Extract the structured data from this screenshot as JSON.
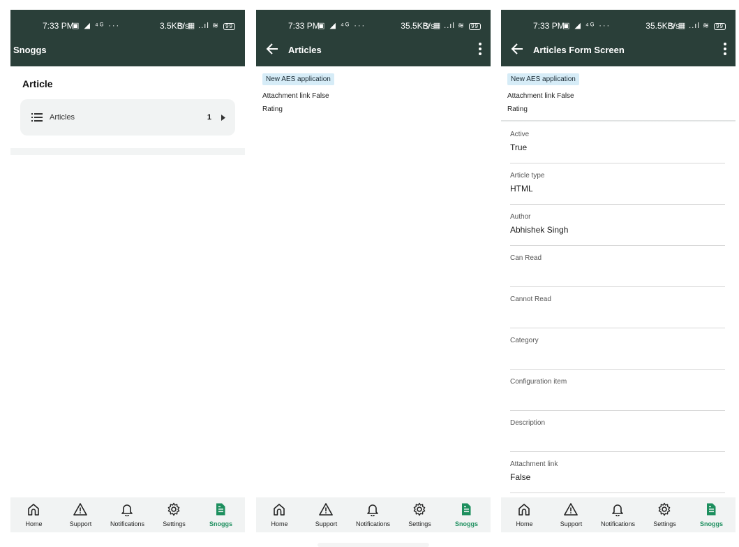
{
  "status": {
    "screen1": {
      "time": "7:33 PM",
      "speed": "3.5KB/s",
      "battery": "99"
    },
    "screen2": {
      "time": "7:33 PM",
      "speed": "35.5KB/s",
      "battery": "99"
    },
    "screen3": {
      "time": "7:33 PM",
      "speed": "35.5KB/s",
      "battery": "99"
    }
  },
  "screen1": {
    "appbar_title": "Snoggs",
    "section_title": "Article",
    "card": {
      "label": "Articles",
      "count": "1"
    }
  },
  "screen2": {
    "appbar_title": "Articles",
    "item": {
      "chip": "New AES application",
      "line1": "Attachment link False",
      "line2": "Rating"
    }
  },
  "screen3": {
    "appbar_title": "Articles Form Screen",
    "header": {
      "chip": "New AES application",
      "line1": "Attachment link False",
      "line2": "Rating"
    },
    "fields": [
      {
        "label": "Active",
        "value": "True"
      },
      {
        "label": "Article type",
        "value": "HTML"
      },
      {
        "label": "Author",
        "value": "Abhishek Singh"
      },
      {
        "label": "Can Read",
        "value": ""
      },
      {
        "label": "Cannot Read",
        "value": ""
      },
      {
        "label": "Category",
        "value": ""
      },
      {
        "label": "Configuration item",
        "value": ""
      },
      {
        "label": "Description",
        "value": ""
      },
      {
        "label": "Attachment link",
        "value": "False"
      }
    ]
  },
  "nav": {
    "items": [
      {
        "label": "Home",
        "icon": "home-icon"
      },
      {
        "label": "Support",
        "icon": "warning-icon"
      },
      {
        "label": "Notifications",
        "icon": "bell-icon"
      },
      {
        "label": "Settings",
        "icon": "gear-icon"
      },
      {
        "label": "Snoggs",
        "icon": "document-icon"
      }
    ],
    "active": "Snoggs"
  },
  "colors": {
    "appbar": "#2a3f39",
    "nav_bg": "#f1f3f3",
    "active": "#1d8f5e",
    "chip": "#d6ecf7"
  }
}
